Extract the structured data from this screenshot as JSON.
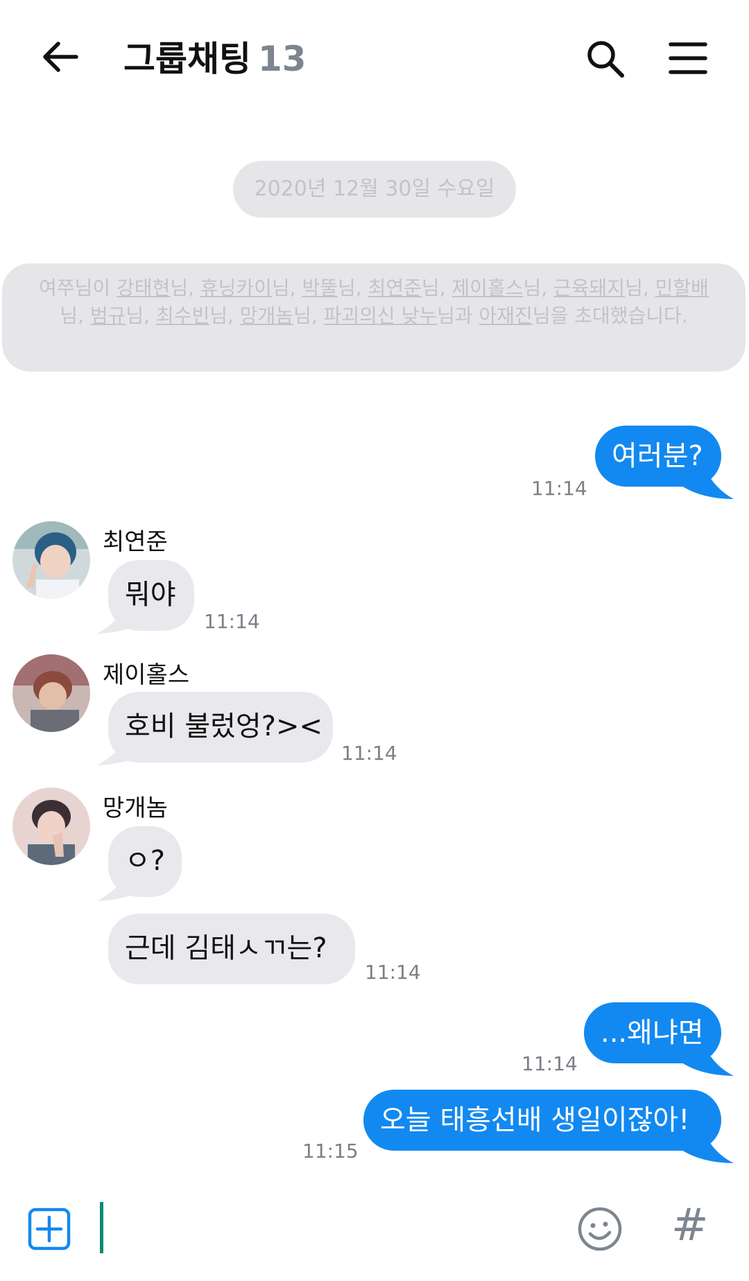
{
  "header": {
    "title": "그룹채팅",
    "member_count": "13"
  },
  "notices": {
    "date": "2020년 12월 30일 수요일",
    "invite": {
      "inviter": "여쭈님이",
      "invitees": [
        "강태현",
        "휴닝카이",
        "박뚤",
        "최연준",
        "제이홀스",
        "근육돼지",
        "민할배",
        "범규",
        "최수빈",
        "망개놈",
        "파괴의신 낮누",
        "아재진"
      ],
      "honorific": "님",
      "comma": ", ",
      "conjunction_suffix": "님과 ",
      "object_suffix": "님을",
      "ending": "초대했습니다."
    }
  },
  "messages": [
    {
      "side": "out",
      "text": "여러분?",
      "time": "11:14"
    },
    {
      "side": "in",
      "sender": "최연준",
      "text": "뭐야",
      "time": "11:14"
    },
    {
      "side": "in",
      "sender": "제이홀스",
      "text": "호비 불렀엉?><",
      "time": "11:14"
    },
    {
      "side": "in",
      "sender": "망개놈",
      "text": "ㅇ?",
      "time": ""
    },
    {
      "side": "in",
      "sender": "망개놈",
      "text": "근데 김태ㅅㄲ는?",
      "time": "11:14"
    },
    {
      "side": "out",
      "text": "...왜냐면",
      "time": "11:14"
    },
    {
      "side": "out",
      "text": "오늘 태흥선배 생일이잖아!",
      "time": "11:15"
    }
  ],
  "input": {
    "icons": {
      "add": "plus-square-icon",
      "emoji": "smiley-icon",
      "hashtag": "hashtag-icon"
    },
    "hashtag_glyph": "#"
  },
  "colors": {
    "outgoing_bubble": "#1289f0",
    "incoming_bubble": "#e9e9ed",
    "notice_bg": "#e6e6e8",
    "notice_text": "#c2c3c7",
    "count_text": "#7c8590",
    "caret": "#0f8a70"
  }
}
